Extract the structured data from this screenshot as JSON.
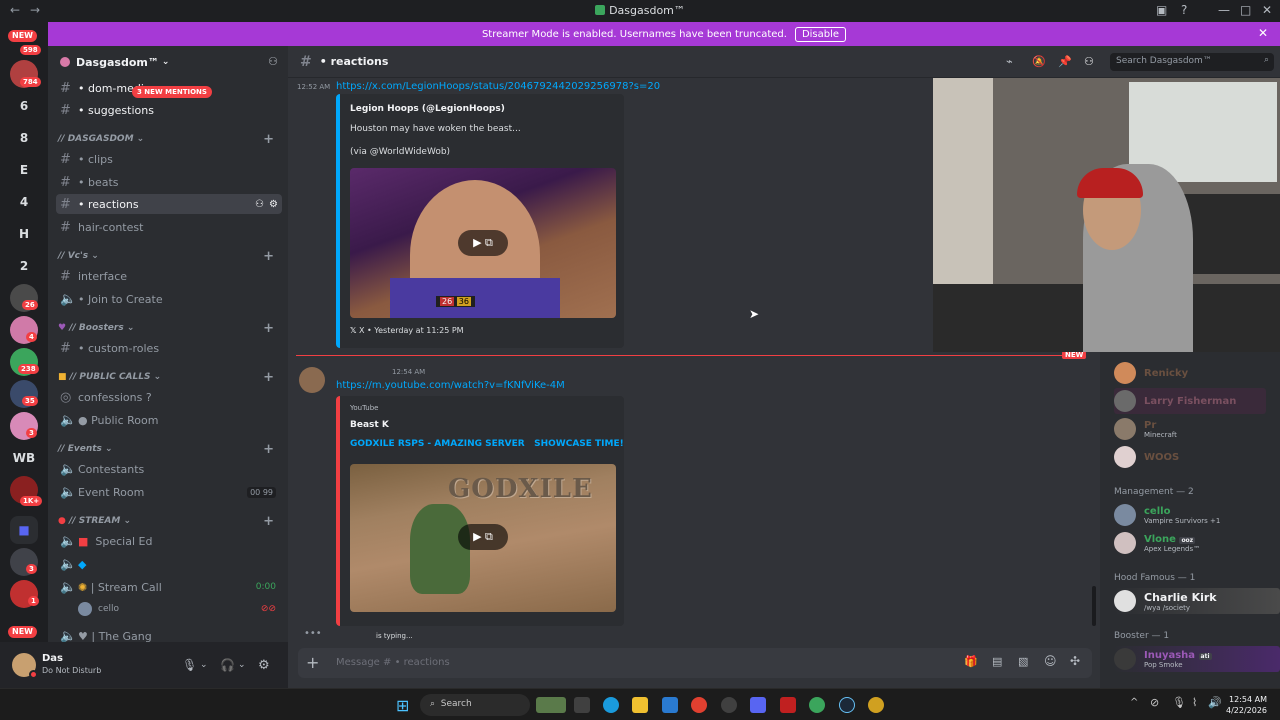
{
  "window": {
    "title": "Dasgasdom™"
  },
  "banner": {
    "text": "Streamer Mode is enabled. Usernames have been truncated.",
    "button": "Disable"
  },
  "rail": {
    "new_top": "NEW",
    "new_bottom": "NEW",
    "badges": [
      "598",
      "784",
      "26",
      "4",
      "238",
      "35",
      "3",
      "1K+",
      "3",
      "1"
    ],
    "letters": [
      "6",
      "8",
      "E",
      "4",
      "H",
      "2",
      "WB"
    ]
  },
  "server": {
    "name": "Dasgasdom™",
    "mentions": "3 NEW MENTIONS"
  },
  "channels": {
    "dom_media": "dom-medi",
    "suggestions": "suggestions",
    "cat_dasgasdom": "// DASGASDOM",
    "clips": "clips",
    "beats": "beats",
    "reactions": "reactions",
    "hair": "hair-contest",
    "cat_vcs": "// Vc's",
    "interface": "interface",
    "join": "Join to Create",
    "cat_boosters": "// Boosters",
    "roles": "custom-roles",
    "cat_public": "// PUBLIC CALLS",
    "confessions": "confessions ?",
    "public_room": "Public Room",
    "cat_events": "// Events",
    "contestants": "Contestants",
    "event_room": "Event Room",
    "event_counts": [
      "00",
      "99"
    ],
    "cat_stream": "// STREAM",
    "special_ed": "Special Ed",
    "stream_call": "Stream Call",
    "stream_time": "0:00",
    "cello_user": "cello",
    "the_gang": "The Gang"
  },
  "user": {
    "name": "Das",
    "status": "Do Not Disturb"
  },
  "chat": {
    "channel": "reactions",
    "search_placeholder": "Search Dasgasdom™",
    "msg1": {
      "time": "12:52 AM",
      "url": "https://x.com/LegionHoops/status/2046792442029256978?s=20",
      "embed_author": "Legion Hoops (@LegionHoops)",
      "embed_text1": "Houston may have woken the beast...",
      "embed_text2": "(via @WorldWideWob)",
      "footer": "X • Yesterday at 11:25 PM",
      "score_a": "26",
      "score_b": "36"
    },
    "new_label": "NEW",
    "msg2": {
      "time": "12:54 AM",
      "url": "https://m.youtube.com/watch?v=fKNfViKe-4M",
      "provider": "YouTube",
      "author": "Beast K",
      "title": "GODXILE RSPS - AMAZING SERVER   SHOWCASE TIME!",
      "thumb_text": "GODXILE"
    },
    "typing": "is typing...",
    "input_placeholder": "Message # • reactions"
  },
  "members": {
    "top": [
      {
        "name": "Renicky",
        "color": "#a06a3a"
      },
      {
        "name": "Larry Fisherman",
        "color": "#a06a3a"
      },
      {
        "name": "Pr",
        "status": "Minecraft",
        "color": "#a06a3a"
      },
      {
        "name": "WOOS",
        "color": "#a06a3a"
      }
    ],
    "cat_management": "Management — 2",
    "management": [
      {
        "name": "cello",
        "status": "Vampire Survivors +1",
        "color": "#3ba55c"
      },
      {
        "name": "Vlone",
        "status": "Apex Legends™",
        "color": "#3ba55c",
        "tag": "ooz"
      }
    ],
    "cat_hood": "Hood Famous — 1",
    "hood": [
      {
        "name": "Charlie Kirk",
        "status": "/wya /society",
        "color": "#f2f3f5"
      }
    ],
    "cat_booster": "Booster — 1",
    "booster": [
      {
        "name": "Inuyasha",
        "status": "Pop Smoke",
        "color": "#9b59b6",
        "tag": "ati"
      }
    ]
  },
  "taskbar": {
    "search": "Search",
    "time": "12:54 AM",
    "date": "4/22/2026"
  }
}
